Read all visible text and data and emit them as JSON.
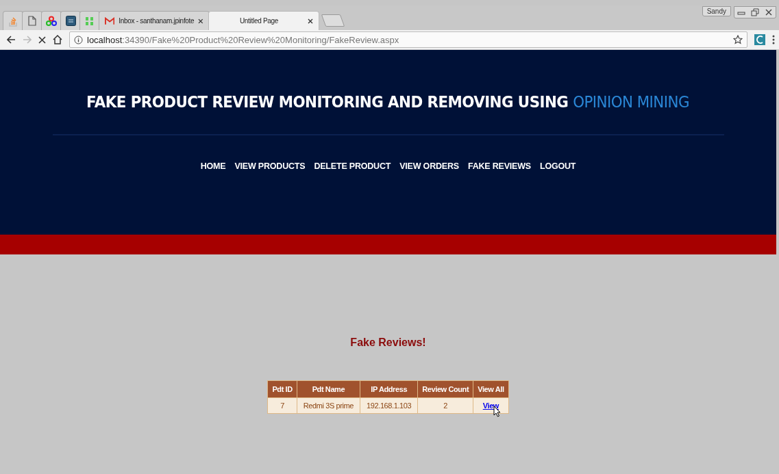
{
  "browser": {
    "tabs": [
      {
        "kind": "icon",
        "selected": false
      },
      {
        "kind": "icon",
        "selected": false
      },
      {
        "kind": "icon",
        "selected": false
      },
      {
        "kind": "icon",
        "selected": false
      },
      {
        "kind": "icon",
        "selected": false
      },
      {
        "kind": "text",
        "title": "Inbox - santhanam.jpinfote",
        "selected": false
      },
      {
        "kind": "text",
        "title": "Untitled Page",
        "selected": true
      }
    ],
    "profile": "Sandy",
    "address": {
      "host": "localhost",
      "path": ":34390/Fake%20Product%20Review%20Monitoring/FakeReview.aspx"
    }
  },
  "header": {
    "title": "FAKE PRODUCT REVIEW MONITORING AND REMOVING USING",
    "title_highlight": "OPINION MINING",
    "nav": [
      "HOME",
      "VIEW PRODUCTS",
      "DELETE PRODUCT",
      "VIEW ORDERS",
      "FAKE REVIEWS",
      "LOGOUT"
    ]
  },
  "content": {
    "heading": "Fake Reviews!",
    "table": {
      "columns": [
        "Pdt ID",
        "Pdt Name",
        "IP Address",
        "Review Count",
        "View All"
      ],
      "rows": [
        {
          "cells": [
            "7",
            "Redmi 3S prime",
            "192.168.1.103",
            "2"
          ],
          "link": "View"
        }
      ]
    }
  }
}
